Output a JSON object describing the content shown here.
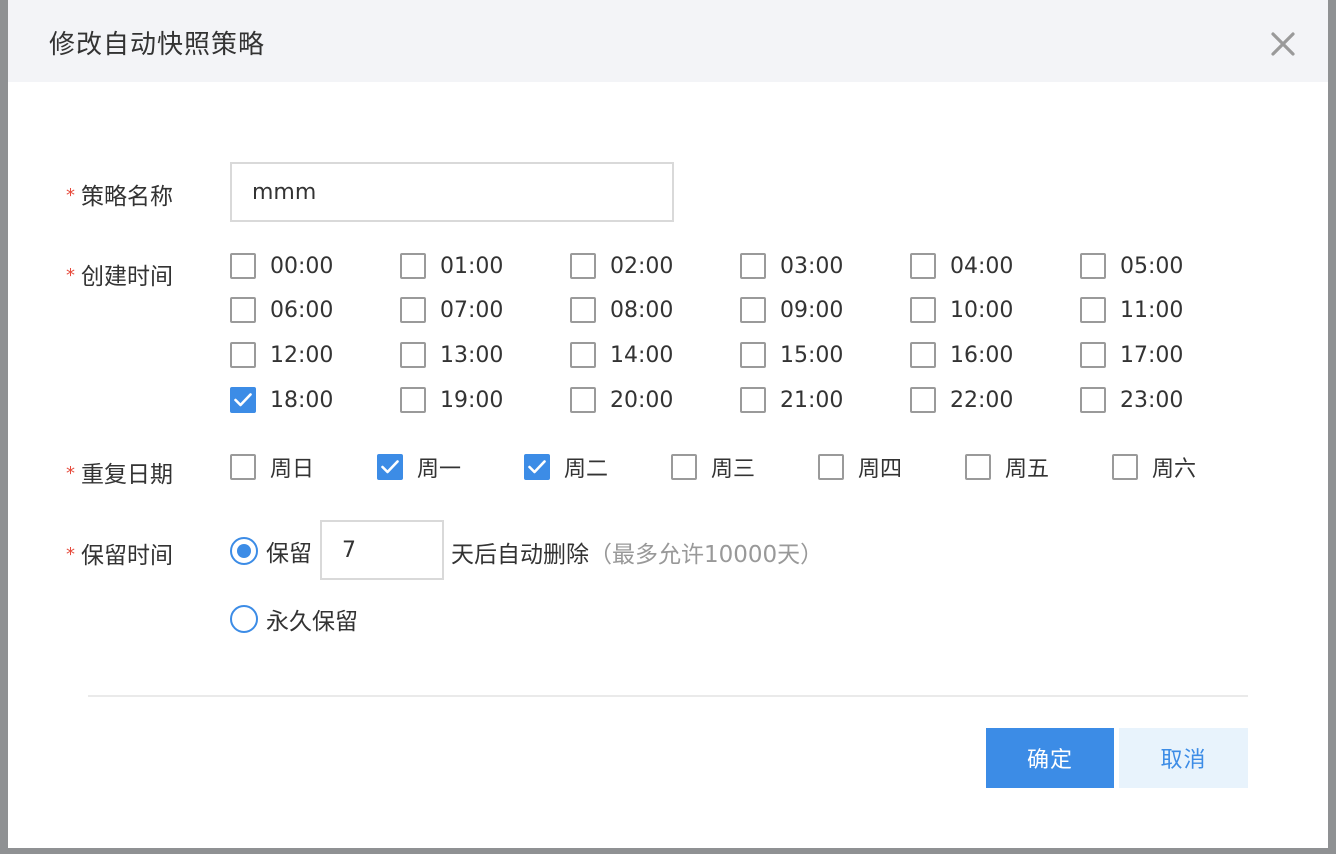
{
  "dialog": {
    "title": "修改自动快照策略"
  },
  "form": {
    "required_mark": "*",
    "name": {
      "label": "策略名称",
      "value": "mmm"
    },
    "create_time": {
      "label": "创建时间",
      "options": [
        {
          "label": "00:00",
          "checked": false
        },
        {
          "label": "01:00",
          "checked": false
        },
        {
          "label": "02:00",
          "checked": false
        },
        {
          "label": "03:00",
          "checked": false
        },
        {
          "label": "04:00",
          "checked": false
        },
        {
          "label": "05:00",
          "checked": false
        },
        {
          "label": "06:00",
          "checked": false
        },
        {
          "label": "07:00",
          "checked": false
        },
        {
          "label": "08:00",
          "checked": false
        },
        {
          "label": "09:00",
          "checked": false
        },
        {
          "label": "10:00",
          "checked": false
        },
        {
          "label": "11:00",
          "checked": false
        },
        {
          "label": "12:00",
          "checked": false
        },
        {
          "label": "13:00",
          "checked": false
        },
        {
          "label": "14:00",
          "checked": false
        },
        {
          "label": "15:00",
          "checked": false
        },
        {
          "label": "16:00",
          "checked": false
        },
        {
          "label": "17:00",
          "checked": false
        },
        {
          "label": "18:00",
          "checked": true
        },
        {
          "label": "19:00",
          "checked": false
        },
        {
          "label": "20:00",
          "checked": false
        },
        {
          "label": "21:00",
          "checked": false
        },
        {
          "label": "22:00",
          "checked": false
        },
        {
          "label": "23:00",
          "checked": false
        }
      ]
    },
    "repeat": {
      "label": "重复日期",
      "options": [
        {
          "label": "周日",
          "checked": false
        },
        {
          "label": "周一",
          "checked": true
        },
        {
          "label": "周二",
          "checked": true
        },
        {
          "label": "周三",
          "checked": false
        },
        {
          "label": "周四",
          "checked": false
        },
        {
          "label": "周五",
          "checked": false
        },
        {
          "label": "周六",
          "checked": false
        }
      ]
    },
    "retention": {
      "label": "保留时间",
      "keep_label": "保留",
      "keep_selected": true,
      "days_value": "7",
      "suffix": "天后自动删除",
      "hint": "（最多允许10000天）",
      "forever_label": "永久保留",
      "forever_selected": false
    }
  },
  "footer": {
    "ok_label": "确定",
    "cancel_label": "取消"
  },
  "colors": {
    "accent": "#3c8ce6",
    "required": "#e64a3b",
    "header_bg": "#f3f4f7"
  }
}
